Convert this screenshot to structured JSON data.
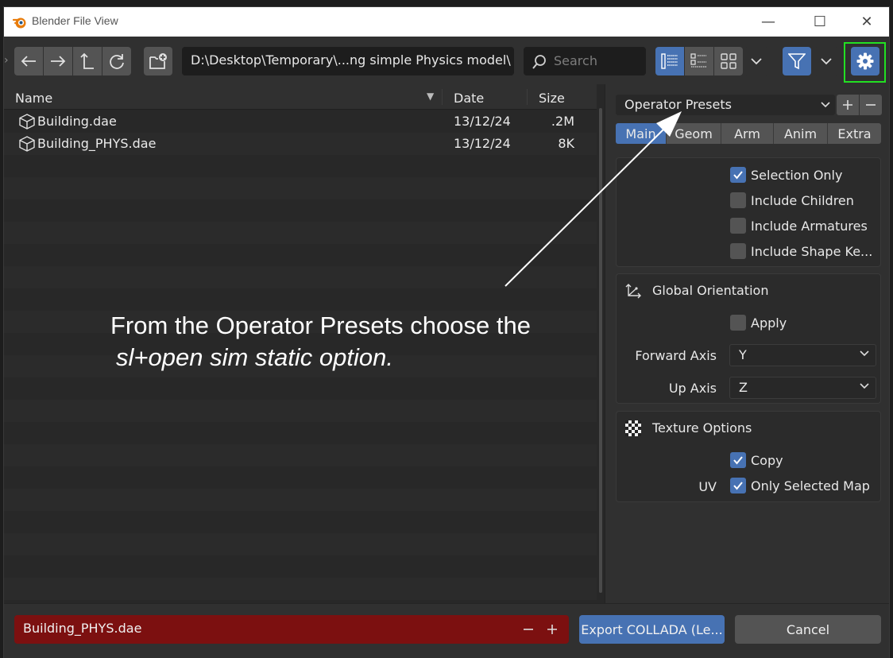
{
  "window": {
    "title": "Blender File View",
    "controls": {
      "minimize": "—",
      "maximize": "☐",
      "close": "✕"
    }
  },
  "toolbar": {
    "path": "D:\\Desktop\\Temporary\\...ng simple Physics model\\",
    "search_placeholder": "Search",
    "icons": [
      "back-arrow-icon",
      "forward-arrow-icon",
      "parent-directory-icon",
      "refresh-icon",
      "new-folder-icon",
      "list-view-icon",
      "thumbnail-view-icon",
      "grid-view-icon",
      "filter-icon",
      "gear-icon"
    ]
  },
  "file_list": {
    "columns": {
      "name": "Name",
      "date": "Date",
      "size": "Size"
    },
    "rows": [
      {
        "name": "Building.dae",
        "date": "13/12/24",
        "size": ".2M"
      },
      {
        "name": "Building_PHYS.dae",
        "date": "13/12/24",
        "size": "8K"
      }
    ]
  },
  "side_panel": {
    "presets_label": "Operator Presets",
    "tabs": [
      {
        "label": "Main",
        "active": true
      },
      {
        "label": "Geom",
        "active": false
      },
      {
        "label": "Arm",
        "active": false
      },
      {
        "label": "Anim",
        "active": false
      },
      {
        "label": "Extra",
        "active": false
      }
    ],
    "options": {
      "selection_only": {
        "label": "Selection Only",
        "checked": true
      },
      "include_children": {
        "label": "Include Children",
        "checked": false
      },
      "include_armatures": {
        "label": "Include Armatures",
        "checked": false
      },
      "include_shape_keys": {
        "label": "Include Shape Ke...",
        "checked": false
      }
    },
    "global_orientation": {
      "title": "Global Orientation",
      "apply": {
        "label": "Apply",
        "checked": false
      },
      "forward_axis_label": "Forward Axis",
      "forward_axis_value": "Y",
      "up_axis_label": "Up Axis",
      "up_axis_value": "Z"
    },
    "texture_options": {
      "title": "Texture Options",
      "copy": {
        "label": "Copy",
        "checked": true
      },
      "uv_label": "UV",
      "only_selected_map": {
        "label": "Only Selected Map",
        "checked": true
      }
    }
  },
  "bottom": {
    "filename": "Building_PHYS.dae",
    "export_label": "Export COLLADA (Le...",
    "cancel_label": "Cancel"
  },
  "annotation": {
    "line1": "From the Operator Presets choose the",
    "line2": "sl+open sim static option."
  },
  "colors": {
    "accent_blue": "#4772b3",
    "filename_red": "#7c1010",
    "highlight_green": "#22e022"
  }
}
